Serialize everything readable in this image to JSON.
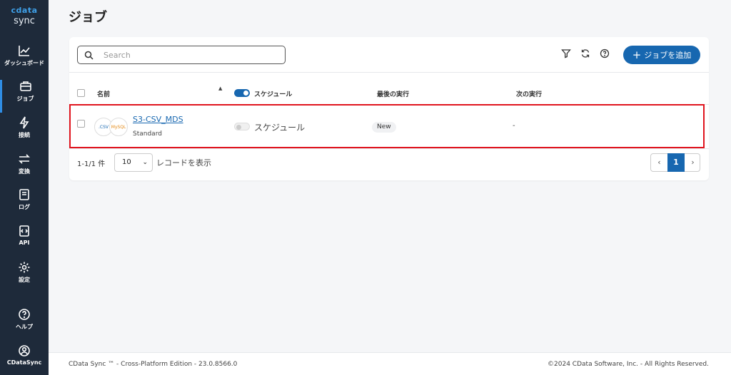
{
  "brand": {
    "top": "cdata",
    "bottom": "sync"
  },
  "nav": [
    {
      "label": "ダッシュボード",
      "icon": "chart-line-icon"
    },
    {
      "label": "ジョブ",
      "icon": "briefcase-icon"
    },
    {
      "label": "接続",
      "icon": "lightning-icon"
    },
    {
      "label": "変換",
      "icon": "transform-arrows-icon"
    },
    {
      "label": "ログ",
      "icon": "book-icon"
    },
    {
      "label": "API",
      "icon": "code-file-icon"
    },
    {
      "label": "設定",
      "icon": "gear-icon"
    },
    {
      "label": "ヘルプ",
      "icon": "help-circle-icon"
    },
    {
      "label": "CDataSync",
      "icon": "user-circle-icon"
    }
  ],
  "page": {
    "title": "ジョブ"
  },
  "toolbar": {
    "search_placeholder": "Search",
    "add_label": "ジョブを追加"
  },
  "table": {
    "headers": {
      "name": "名前",
      "schedule": "スケジュール",
      "last_run": "最後の実行",
      "next_run": "次の実行"
    },
    "rows": [
      {
        "name": "S3-CSV_MDS",
        "type": "Standard",
        "source_icon_text": ".CSV",
        "dest_icon_text": "MySQL",
        "schedule_label": "スケジュール",
        "schedule_enabled": false,
        "last_run": "New",
        "next_run": "-"
      }
    ]
  },
  "pagination": {
    "count": "1-1/1 件",
    "page_size": "10",
    "records_label": "レコードを表示",
    "current_page": "1",
    "prev": "‹",
    "next": "›"
  },
  "footer": {
    "left": "CData Sync ™ - Cross-Platform Edition - 23.0.8566.0",
    "right": "©2024 CData Software, Inc. - All Rights Reserved."
  },
  "colors": {
    "sidebar": "#1e2a3a",
    "accent": "#1767b0",
    "highlight": "#e0141e"
  }
}
